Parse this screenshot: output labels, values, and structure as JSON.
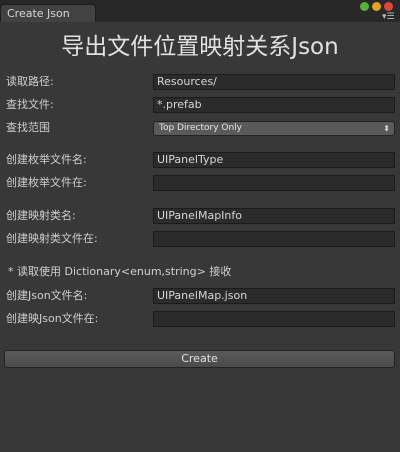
{
  "window": {
    "tab_label": "Create Json",
    "title": "导出文件位置映射关系Json"
  },
  "form": {
    "read_path": {
      "label": "读取路径:",
      "value": "Resources/"
    },
    "find_file": {
      "label": "查找文件:",
      "value": "*.prefab"
    },
    "find_scope": {
      "label": "查找范围",
      "value": "Top Directory Only"
    },
    "enum_file_name": {
      "label": "创建枚举文件名:",
      "value": "UIPanelType"
    },
    "enum_file_location": {
      "label": "创建枚举文件在:",
      "value": ""
    },
    "map_class_name": {
      "label": "创建映射类名:",
      "value": "UIPanelMapInfo"
    },
    "map_class_location": {
      "label": "创建映射类文件在:",
      "value": ""
    },
    "note": "* 读取使用 Dictionary<enum,string> 接收",
    "json_file_name": {
      "label": "创建Json文件名:",
      "value": "UIPanelMap.json"
    },
    "json_file_location": {
      "label": "创建映Json文件在:",
      "value": ""
    }
  },
  "buttons": {
    "create": "Create"
  },
  "icons": {
    "window_controls": [
      "green-circle",
      "yellow-circle",
      "red-circle"
    ],
    "menu": "hamburger-menu-icon",
    "dropdown_arrow": "updown-arrow-icon"
  },
  "colors": {
    "background": "#383838",
    "field": "#2b2b2b",
    "title_bar": "#282828"
  }
}
